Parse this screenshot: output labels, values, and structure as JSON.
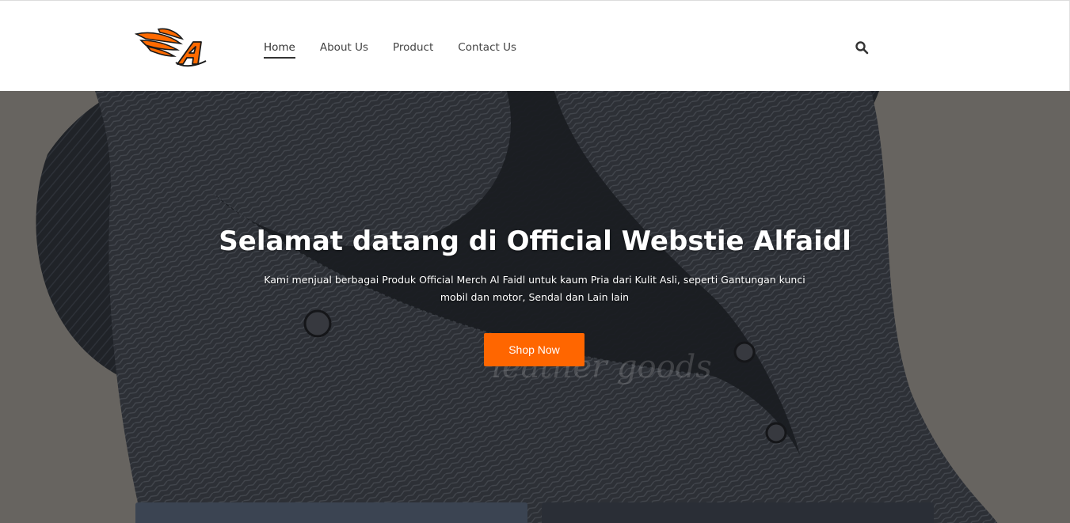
{
  "brand": {
    "logo_letter": "A"
  },
  "nav": {
    "items": [
      {
        "label": "Home",
        "active": true
      },
      {
        "label": "About Us",
        "active": false
      },
      {
        "label": "Product",
        "active": false
      },
      {
        "label": "Contact Us",
        "active": false
      }
    ]
  },
  "header": {
    "search_icon": "search-icon"
  },
  "hero": {
    "title": "Selamat datang di Official Webstie Alfaidl",
    "subtitle": "Kami menjual berbagai Produk Official Merch Al Faidl untuk kaum Pria dari Kulit Asli, seperti Gantungan kunci mobil dan motor, Sendal dan Lain lain",
    "cta_label": "Shop Now",
    "watermark_line_2": "leather goods"
  },
  "colors": {
    "accent": "#ff6600",
    "header_bg": "#ffffff",
    "nav_text": "#444444",
    "hero_overlay": "#7e7b76"
  }
}
